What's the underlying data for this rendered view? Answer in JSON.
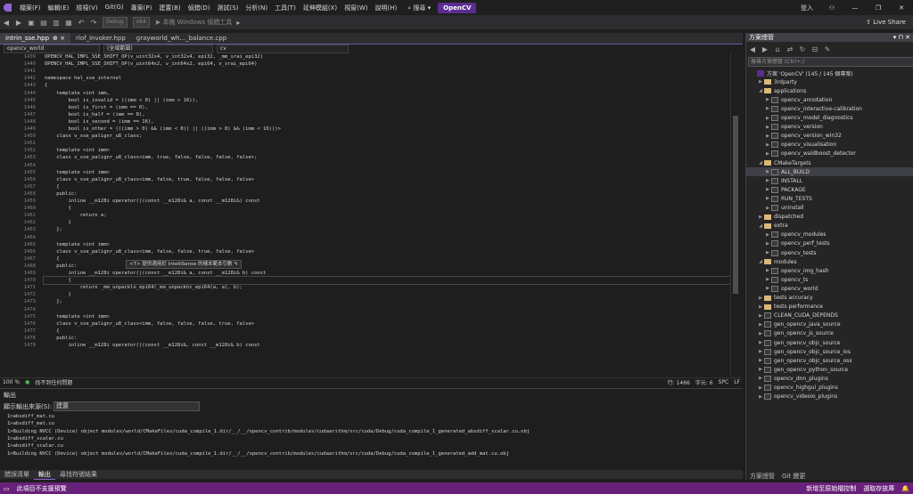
{
  "menu": [
    "檔案(F)",
    "編輯(E)",
    "檢視(V)",
    "Git(G)",
    "專案(P)",
    "建置(B)",
    "偵錯(D)",
    "測試(S)",
    "分析(N)",
    "工具(T)",
    "延伸模組(X)",
    "視窗(W)",
    "說明(H)"
  ],
  "search_label": "搜尋",
  "solution_name": "OpenCV",
  "login_label": "登入",
  "toolbar": {
    "config": "Debug",
    "platform": "x64",
    "start_label": "▶ 本機 Windows 偵錯工具",
    "liveshare": "Live Share"
  },
  "tabs": [
    {
      "label": "intrin_sse.hpp",
      "close": "⊕ ×"
    },
    {
      "label": "rlof_invoker.hpp",
      "close": ""
    },
    {
      "label": "grayworld_wh..._balance.cpp",
      "close": ""
    }
  ],
  "nav": {
    "project": "opencv_world",
    "scope": "(全域範圍)",
    "member": "cv"
  },
  "code_lines": [
    {
      "n": "1439",
      "t": "OPENCV_HAL_IMPL_SSE_SHIFT_OP(v_uint32x4, v_int32x4, epi32, _mm_srai_epi32)"
    },
    {
      "n": "1440",
      "t": "OPENCV_HAL_IMPL_SSE_SHIFT_OP(v_uint64x2, v_int64x2, epi64, v_srai_epi64)"
    },
    {
      "n": "1441",
      "t": ""
    },
    {
      "n": "1442",
      "t": "namespace hal_sse_internal"
    },
    {
      "n": "1443",
      "t": "{"
    },
    {
      "n": "1444",
      "t": "    template <int imm,"
    },
    {
      "n": "1445",
      "t": "        bool is_invalid = ((imm < 0) || (imm > 16)),"
    },
    {
      "n": "1446",
      "t": "        bool is_first = (imm == 0),"
    },
    {
      "n": "1447",
      "t": "        bool is_half = (imm == 8),"
    },
    {
      "n": "1448",
      "t": "        bool is_second = (imm == 16),"
    },
    {
      "n": "1449",
      "t": "        bool is_other = (((imm > 0) && (imm < 8)) || ((imm > 8) && (imm < 16)))>"
    },
    {
      "n": "1450",
      "t": "    class v_sse_palignr_u8_class;"
    },
    {
      "n": "1451",
      "t": ""
    },
    {
      "n": "1452",
      "t": "    template <int imm>"
    },
    {
      "n": "1453",
      "t": "    class v_sse_palignr_u8_class<imm, true, false, false, false, false>;"
    },
    {
      "n": "1454",
      "t": ""
    },
    {
      "n": "1455",
      "t": "    template <int imm>"
    },
    {
      "n": "1456",
      "t": "    class v_sse_palignr_u8_class<imm, false, true, false, false, false>"
    },
    {
      "n": "1457",
      "t": "    {"
    },
    {
      "n": "1458",
      "t": "    public:"
    },
    {
      "n": "1459",
      "t": "        inline __m128i operator()(const __m128i& a, const __m128i&) const"
    },
    {
      "n": "1460",
      "t": "        {"
    },
    {
      "n": "1461",
      "t": "            return a;"
    },
    {
      "n": "1462",
      "t": "        }"
    },
    {
      "n": "1463",
      "t": "    };"
    },
    {
      "n": "1464",
      "t": ""
    },
    {
      "n": "1465",
      "t": "    template <int imm>"
    },
    {
      "n": "1466",
      "t": "    class v_sse_palignr_u8_class<imm, false, false, true, false, false>"
    },
    {
      "n": "1467",
      "t": "    {"
    },
    {
      "n": "1468",
      "t": "    public:"
    },
    {
      "n": "1469",
      "t": "        inline __m128i operator()(const __m128i& a, const __m128i& b) const"
    },
    {
      "n": "1470",
      "t": "        {"
    },
    {
      "n": "1471",
      "t": "            return _mm_unpacklo_epi64(_mm_unpackhi_epi64(a, a), b);"
    },
    {
      "n": "1472",
      "t": "        }"
    },
    {
      "n": "1473",
      "t": "    };"
    },
    {
      "n": "1474",
      "t": ""
    },
    {
      "n": "1475",
      "t": "    template <int imm>"
    },
    {
      "n": "1476",
      "t": "    class v_sse_palignr_u8_class<imm, false, false, false, true, false>"
    },
    {
      "n": "1477",
      "t": "    {"
    },
    {
      "n": "1478",
      "t": "    public:"
    },
    {
      "n": "1479",
      "t": "        inline __m128i operator()(const __m128i&, const __m128i& b) const"
    }
  ],
  "tooltip": "<T> 提供適用於 IntelliSense 的樣本範本引數 ✎",
  "editor_status": {
    "zoom": "100 %",
    "issues": "找不到任何問題",
    "line": "行: 1466",
    "col": "字元: 6",
    "spc": "SPC",
    "crlf": "LF"
  },
  "output": {
    "title": "輸出",
    "source_label": "顯示輸出來源(S):",
    "source_value": "建置",
    "lines": [
      "1>absdiff_mat.cu",
      "1>absdiff_mat.cu",
      "1>Building NVCC (Device) object modules/world/CMakeFiles/cuda_compile_1.dir/__/__/opencv_contrib/modules/cudaarithm/src/cuda/Debug/cuda_compile_1_generated_absdiff_scalar.cu.obj",
      "1>absdiff_scalar.cu",
      "1>absdiff_scalar.cu",
      "1>Building NVCC (Device) object modules/world/CMakeFiles/cuda_compile_1.dir/__/__/opencv_contrib/modules/cudaarithm/src/cuda/Debug/cuda_compile_1_generated_add_mat.cu.obj"
    ]
  },
  "bottom_tabs": [
    "錯誤清單",
    "輸出",
    "尋找符號結果"
  ],
  "status": {
    "left": "此項目不支援預覽",
    "right1": "新增至原始檔控制",
    "right2": "選取存放庫"
  },
  "solution_explorer": {
    "title": "方案總管",
    "search_placeholder": "搜尋方案總管 (Ctrl+;)",
    "bottom_tabs": [
      "方案總管",
      "Git 變更"
    ],
    "items": [
      {
        "label": "方案 'OpenCV' (145 / 145 個專案)",
        "level": 0,
        "kind": "sln",
        "arrow": ""
      },
      {
        "label": "3rdparty",
        "level": 1,
        "kind": "folder",
        "arrow": "▶"
      },
      {
        "label": "applications",
        "level": 1,
        "kind": "folder",
        "arrow": "◢"
      },
      {
        "label": "opencv_annotation",
        "level": 2,
        "kind": "proj",
        "arrow": "▶"
      },
      {
        "label": "opencv_interactive-calibration",
        "level": 2,
        "kind": "proj",
        "arrow": "▶"
      },
      {
        "label": "opencv_model_diagnostics",
        "level": 2,
        "kind": "proj",
        "arrow": "▶"
      },
      {
        "label": "opencv_version",
        "level": 2,
        "kind": "proj",
        "arrow": "▶"
      },
      {
        "label": "opencv_version_win32",
        "level": 2,
        "kind": "proj",
        "arrow": "▶"
      },
      {
        "label": "opencv_visualisation",
        "level": 2,
        "kind": "proj",
        "arrow": "▶"
      },
      {
        "label": "opencv_waldboost_detector",
        "level": 2,
        "kind": "proj",
        "arrow": "▶"
      },
      {
        "label": "CMakeTargets",
        "level": 1,
        "kind": "folder",
        "arrow": "◢"
      },
      {
        "label": "ALL_BUILD",
        "level": 2,
        "kind": "proj",
        "arrow": "▶",
        "sel": true
      },
      {
        "label": "INSTALL",
        "level": 2,
        "kind": "proj",
        "arrow": "▶"
      },
      {
        "label": "PACKAGE",
        "level": 2,
        "kind": "proj",
        "arrow": "▶"
      },
      {
        "label": "RUN_TESTS",
        "level": 2,
        "kind": "proj",
        "arrow": "▶"
      },
      {
        "label": "uninstall",
        "level": 2,
        "kind": "proj",
        "arrow": "▶"
      },
      {
        "label": "dispatched",
        "level": 1,
        "kind": "folder",
        "arrow": "▶"
      },
      {
        "label": "extra",
        "level": 1,
        "kind": "folder",
        "arrow": "◢"
      },
      {
        "label": "opencv_modules",
        "level": 2,
        "kind": "proj",
        "arrow": "▶"
      },
      {
        "label": "opencv_perf_tests",
        "level": 2,
        "kind": "proj",
        "arrow": "▶"
      },
      {
        "label": "opencv_tests",
        "level": 2,
        "kind": "proj",
        "arrow": "▶"
      },
      {
        "label": "modules",
        "level": 1,
        "kind": "folder",
        "arrow": "◢"
      },
      {
        "label": "opencv_img_hash",
        "level": 2,
        "kind": "proj",
        "arrow": "▶"
      },
      {
        "label": "opencv_ts",
        "level": 2,
        "kind": "proj",
        "arrow": "▶"
      },
      {
        "label": "opencv_world",
        "level": 2,
        "kind": "proj",
        "arrow": "▶"
      },
      {
        "label": "tests accuracy",
        "level": 1,
        "kind": "folder",
        "arrow": "▶"
      },
      {
        "label": "tests performance",
        "level": 1,
        "kind": "folder",
        "arrow": "▶"
      },
      {
        "label": "CLEAN_CUDA_DEPENDS",
        "level": 1,
        "kind": "proj",
        "arrow": "▶"
      },
      {
        "label": "gen_opencv_java_source",
        "level": 1,
        "kind": "proj",
        "arrow": "▶"
      },
      {
        "label": "gen_opencv_js_source",
        "level": 1,
        "kind": "proj",
        "arrow": "▶"
      },
      {
        "label": "gen_opencv_objc_source",
        "level": 1,
        "kind": "proj",
        "arrow": "▶"
      },
      {
        "label": "gen_opencv_objc_source_ios",
        "level": 1,
        "kind": "proj",
        "arrow": "▶"
      },
      {
        "label": "gen_opencv_objc_source_osx",
        "level": 1,
        "kind": "proj",
        "arrow": "▶"
      },
      {
        "label": "gen_opencv_python_source",
        "level": 1,
        "kind": "proj",
        "arrow": "▶"
      },
      {
        "label": "opencv_dnn_plugins",
        "level": 1,
        "kind": "proj",
        "arrow": "▶"
      },
      {
        "label": "opencv_highgui_plugins",
        "level": 1,
        "kind": "proj",
        "arrow": "▶"
      },
      {
        "label": "opencv_videoio_plugins",
        "level": 1,
        "kind": "proj",
        "arrow": "▶"
      }
    ]
  }
}
